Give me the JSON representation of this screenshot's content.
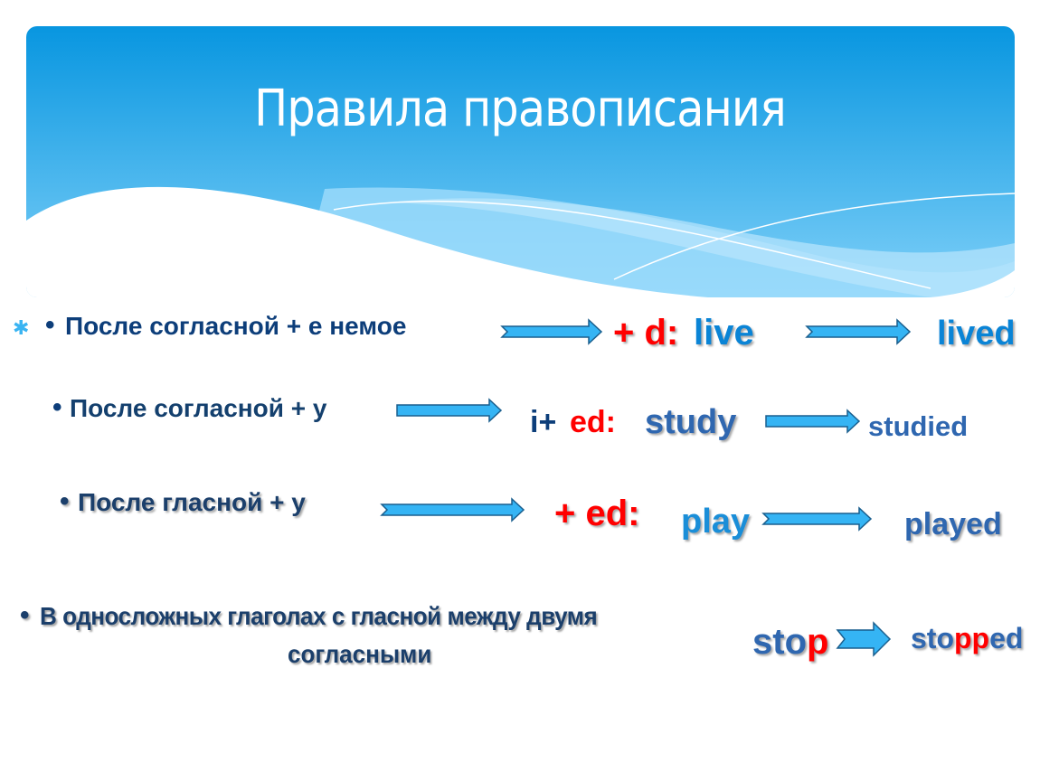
{
  "slide": {
    "title": "Правила правописания",
    "colors": {
      "header_top": "#0896e0",
      "header_bottom": "#7fd0f8",
      "arrow_fill": "#35b4f4",
      "arrow_stroke": "#1a5f8e",
      "rule_text": "#0d3e7a",
      "suffix_red": "#ff0000",
      "word_blue": "#0a84d6"
    },
    "slide_bullet_icon": "asterisk-bullet-icon",
    "rules": [
      {
        "condition": "После согласной + е немое",
        "suffix_prefix": "+ d:",
        "base_word": "live",
        "result_word": "lived"
      },
      {
        "condition": "После согласной  + y",
        "suffix_marker": "i+",
        "suffix_prefix": "ed:",
        "base_word": "study",
        "result_word": "studied"
      },
      {
        "condition": "После гласной + y",
        "suffix_prefix": "+ ed:",
        "base_word": "play",
        "result_word": "played"
      },
      {
        "condition_line1": "В односложных глаголах с гласной между двумя",
        "condition_line2": "согласными",
        "base_word_part": "sto",
        "base_word_highlight": "p",
        "result_part1": "sto",
        "result_highlight": "pp",
        "result_part2": "ed"
      }
    ],
    "bullet": "•"
  }
}
